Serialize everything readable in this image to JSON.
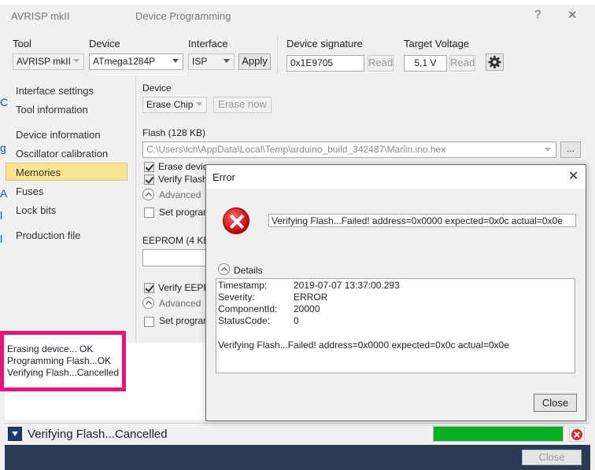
{
  "window": {
    "app_name": "AVRISP mkII",
    "title": "Device Programming",
    "help_glyph": "?",
    "close_glyph": "✕"
  },
  "toolbar": {
    "tool_label": "Tool",
    "tool_value": "AVRISP mkII",
    "device_label": "Device",
    "device_value": "ATmega1284P",
    "interface_label": "Interface",
    "interface_value": "ISP",
    "apply_label": "Apply",
    "signature_label": "Device signature",
    "signature_value": "0x1E9705",
    "signature_read_label": "Read",
    "voltage_label": "Target Voltage",
    "voltage_value": "5,1 V",
    "voltage_read_label": "Read",
    "settings_icon": "gear-icon"
  },
  "sidebar": {
    "items": [
      {
        "label": "Interface settings"
      },
      {
        "label": "Tool information"
      },
      {
        "label": "Device information"
      },
      {
        "label": "Oscillator calibration"
      },
      {
        "label": "Memories",
        "active": true
      },
      {
        "label": "Fuses"
      },
      {
        "label": "Lock bits"
      },
      {
        "label": "Production file"
      }
    ],
    "edge_chars": [
      "C",
      "g",
      "A",
      "l",
      "l"
    ]
  },
  "memories": {
    "device_section": "Device",
    "erase_mode": "Erase Chip",
    "erase_now_label": "Erase now",
    "flash_section": "Flash (128 KB)",
    "flash_path": "C:\\Users\\lch\\AppData\\Local\\Temp\\arduino_build_342487\\Marlin.ino.hex",
    "browse_label": "...",
    "flash_erase_label": "Erase devic",
    "flash_verify_label": "Verify Flash",
    "flash_advanced_label": "Advanced",
    "flash_setprog_label": "Set progran",
    "eeprom_section": "EEPROM (4 KB)",
    "eeprom_verify_label": "Verify EEPR",
    "eeprom_advanced_label": "Advanced",
    "eeprom_setprog_label": "Set program"
  },
  "log": {
    "lines": [
      "Erasing device... OK",
      "Programming Flash...OK",
      "Verifying Flash...Cancelled"
    ]
  },
  "status": {
    "text": "Verifying Flash...Cancelled",
    "progress_pct": 100,
    "progress_color": "#06b025",
    "close_label": "Close"
  },
  "error_dialog": {
    "title": "Error",
    "close_glyph": "✕",
    "message": "Verifying Flash...Failed! address=0x0000 expected=0x0c actual=0x0e",
    "details_label": "Details",
    "details": [
      {
        "key": "Timestamp:",
        "value": "2019-07-07 13:37:00.293"
      },
      {
        "key": "Severity:",
        "value": "ERROR"
      },
      {
        "key": "ComponentId:",
        "value": "20000"
      },
      {
        "key": "StatusCode:",
        "value": "0"
      }
    ],
    "details_message": "Verifying Flash...Failed! address=0x0000 expected=0x0c actual=0x0e",
    "close_button_label": "Close",
    "icon": "error-icon"
  },
  "colors": {
    "highlight_border": "#e8127c",
    "nav_active": "#fbe394",
    "footer": "#2b3a55",
    "error_red": "#c40000"
  }
}
